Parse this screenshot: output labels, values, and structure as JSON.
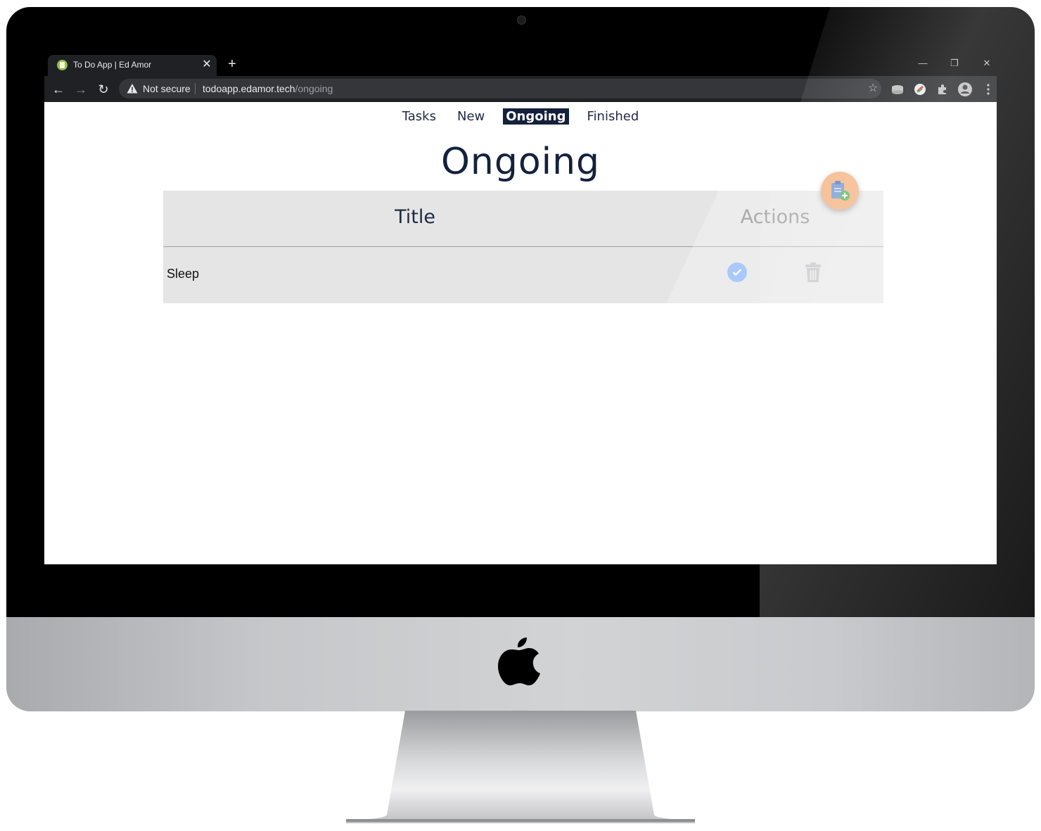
{
  "browser": {
    "tab_title": "To Do App | Ed Amor",
    "tab_close": "✕",
    "new_tab": "+",
    "window_controls": {
      "minimize": "—",
      "restore": "❐",
      "close": "✕"
    },
    "nav": {
      "back": "←",
      "forward": "→",
      "reload": "↻"
    },
    "security_label": "Not secure",
    "url_host": "todoapp.edamor.tech",
    "url_path": "/ongoing",
    "bookmark": "☆"
  },
  "app": {
    "nav_items": [
      {
        "label": "Tasks",
        "active": false
      },
      {
        "label": "New",
        "active": false
      },
      {
        "label": "Ongoing",
        "active": true
      },
      {
        "label": "Finished",
        "active": false
      }
    ],
    "page_title": "Ongoing",
    "table": {
      "headers": {
        "title": "Title",
        "actions": "Actions"
      },
      "rows": [
        {
          "title": "Sleep"
        }
      ]
    }
  },
  "colors": {
    "navy": "#14213d",
    "fab": "#f4b88a",
    "done": "#8ab4f8",
    "table_bg": "#e5e5e5",
    "browser_dark": "#202124"
  },
  "icons": [
    "warning-icon",
    "star-icon",
    "extension-icon",
    "profile-icon",
    "menu-icon",
    "check-circle-icon",
    "trash-icon",
    "add-clipboard-icon",
    "apple-logo-icon"
  ]
}
